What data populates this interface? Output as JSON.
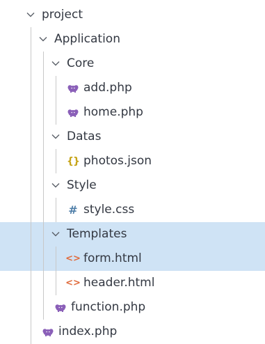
{
  "tree": [
    {
      "label": "project",
      "type": "folder",
      "depth": 0,
      "expanded": true,
      "selected": false
    },
    {
      "label": "Application",
      "type": "folder",
      "depth": 1,
      "expanded": true,
      "selected": false
    },
    {
      "label": "Core",
      "type": "folder",
      "depth": 2,
      "expanded": true,
      "selected": false
    },
    {
      "label": "add.php",
      "type": "php",
      "depth": 3,
      "selected": false
    },
    {
      "label": "home.php",
      "type": "php",
      "depth": 3,
      "selected": false
    },
    {
      "label": "Datas",
      "type": "folder",
      "depth": 2,
      "expanded": true,
      "selected": false
    },
    {
      "label": "photos.json",
      "type": "json",
      "depth": 3,
      "selected": false
    },
    {
      "label": "Style",
      "type": "folder",
      "depth": 2,
      "expanded": true,
      "selected": false
    },
    {
      "label": "style.css",
      "type": "css",
      "depth": 3,
      "selected": false
    },
    {
      "label": "Templates",
      "type": "folder",
      "depth": 2,
      "expanded": true,
      "selected": true
    },
    {
      "label": "form.html",
      "type": "html",
      "depth": 3,
      "selected": true
    },
    {
      "label": "header.html",
      "type": "html",
      "depth": 3,
      "selected": false
    },
    {
      "label": "function.php",
      "type": "php",
      "depth": 2,
      "selected": false
    },
    {
      "label": "index.php",
      "type": "php",
      "depth": 1,
      "selected": false
    }
  ],
  "icons": {
    "folder": "chevron-down-icon",
    "php": "php-elephant-icon",
    "json": "json-braces-icon",
    "css": "css-hash-icon",
    "html": "html-code-icon"
  },
  "colors": {
    "selection": "#cfe3f5",
    "php": "#8a5fb8",
    "json": "#c6a417",
    "css": "#4e7ea8",
    "html": "#e06b3c",
    "text": "#333842",
    "chevron": "#5a5f68"
  }
}
